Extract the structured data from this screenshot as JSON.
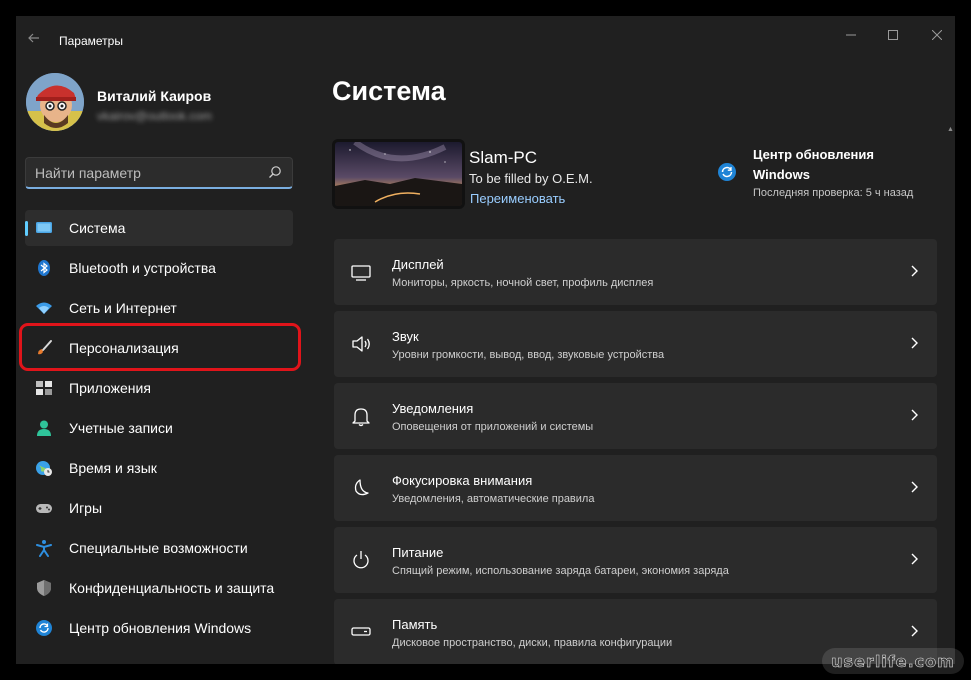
{
  "window": {
    "title": "Параметры",
    "controls": {
      "minimize": "—",
      "maximize": "☐",
      "close": "✕"
    }
  },
  "profile": {
    "name": "Виталий Каиров",
    "email": "vkairov@outlook.com"
  },
  "search": {
    "placeholder": "Найти параметр"
  },
  "sidebar": {
    "items": [
      {
        "label": "Система",
        "icon": "system-display-icon",
        "active": true
      },
      {
        "label": "Bluetooth и устройства",
        "icon": "bluetooth-icon"
      },
      {
        "label": "Сеть и Интернет",
        "icon": "wifi-icon"
      },
      {
        "label": "Персонализация",
        "icon": "brush-icon",
        "highlighted": true
      },
      {
        "label": "Приложения",
        "icon": "apps-icon"
      },
      {
        "label": "Учетные записи",
        "icon": "account-icon"
      },
      {
        "label": "Время и язык",
        "icon": "globe-clock-icon"
      },
      {
        "label": "Игры",
        "icon": "gamepad-icon"
      },
      {
        "label": "Специальные возможности",
        "icon": "accessibility-icon"
      },
      {
        "label": "Конфиденциальность и защита",
        "icon": "shield-icon"
      },
      {
        "label": "Центр обновления Windows",
        "icon": "windows-update-icon"
      }
    ]
  },
  "main": {
    "title": "Система",
    "device": {
      "name": "Slam-PC",
      "model": "To be filled by O.E.M.",
      "rename": "Переименовать"
    },
    "update": {
      "title": "Центр обновления Windows",
      "subtitle": "Последняя проверка: 5 ч назад"
    },
    "cards": [
      {
        "title": "Дисплей",
        "subtitle": "Мониторы, яркость, ночной свет, профиль дисплея",
        "icon": "display-icon"
      },
      {
        "title": "Звук",
        "subtitle": "Уровни громкости, вывод, ввод, звуковые устройства",
        "icon": "speaker-icon"
      },
      {
        "title": "Уведомления",
        "subtitle": "Оповещения от приложений и системы",
        "icon": "bell-icon"
      },
      {
        "title": "Фокусировка внимания",
        "subtitle": "Уведомления, автоматические правила",
        "icon": "moon-icon"
      },
      {
        "title": "Питание",
        "subtitle": "Спящий режим, использование заряда батареи, экономия заряда",
        "icon": "power-icon"
      },
      {
        "title": "Память",
        "subtitle": "Дисковое пространство, диски, правила конфигурации",
        "icon": "storage-icon"
      }
    ]
  },
  "watermark": "userlife.com",
  "colors": {
    "background": "#202020",
    "card": "#2b2b2b",
    "accent": "#60cdff",
    "link": "#99cdff",
    "highlight": "#e0141a"
  }
}
